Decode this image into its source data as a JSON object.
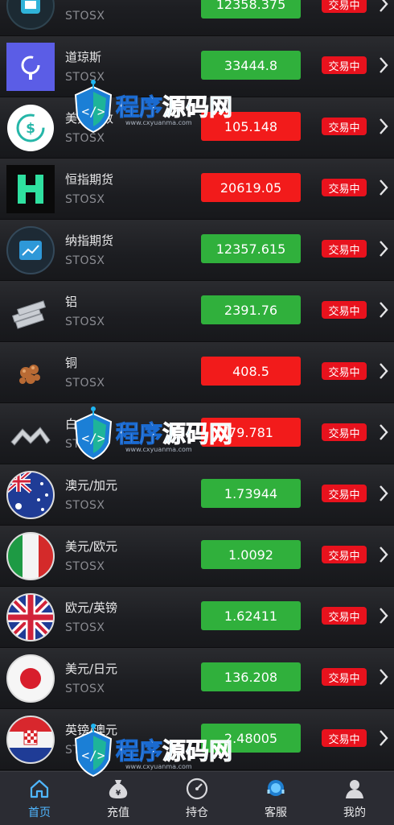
{
  "rows": [
    {
      "name": "",
      "sub": "STOSX",
      "price": "12358.375",
      "dir": "up",
      "status": "交易中",
      "icon": "circle-app-icon"
    },
    {
      "name": "道琼斯",
      "sub": "STOSX",
      "price": "33444.8",
      "dir": "up",
      "status": "交易中",
      "icon": "dow-jones-logo-icon"
    },
    {
      "name": "美元指数",
      "sub": "STOSX",
      "price": "105.148",
      "dir": "down",
      "status": "交易中",
      "icon": "dollar-index-icon"
    },
    {
      "name": "恒指期货",
      "sub": "STOSX",
      "price": "20619.05",
      "dir": "down",
      "status": "交易中",
      "icon": "hang-seng-logo-icon"
    },
    {
      "name": "纳指期货",
      "sub": "STOSX",
      "price": "12357.615",
      "dir": "up",
      "status": "交易中",
      "icon": "nasdaq-chart-icon"
    },
    {
      "name": "铝",
      "sub": "STOSX",
      "price": "2391.76",
      "dir": "up",
      "status": "交易中",
      "icon": "aluminum-bars-icon"
    },
    {
      "name": "铜",
      "sub": "STOSX",
      "price": "408.5",
      "dir": "down",
      "status": "交易中",
      "icon": "copper-nuggets-icon"
    },
    {
      "name": "白",
      "sub": "STOSX",
      "price": "79.781",
      "dir": "down",
      "status": "交易中",
      "icon": "metal-trend-icon"
    },
    {
      "name": "澳元/加元",
      "sub": "STOSX",
      "price": "1.73944",
      "dir": "up",
      "status": "交易中",
      "icon": "australia-flag-icon"
    },
    {
      "name": "美元/欧元",
      "sub": "STOSX",
      "price": "1.0092",
      "dir": "up",
      "status": "交易中",
      "icon": "italy-flag-icon"
    },
    {
      "name": "欧元/英镑",
      "sub": "STOSX",
      "price": "1.62411",
      "dir": "up",
      "status": "交易中",
      "icon": "uk-flag-icon"
    },
    {
      "name": "美元/日元",
      "sub": "STOSX",
      "price": "136.208",
      "dir": "up",
      "status": "交易中",
      "icon": "japan-flag-icon"
    },
    {
      "name": "英镑/澳元",
      "sub": "STOSX",
      "price": "2.48005",
      "dir": "up",
      "status": "交易中",
      "icon": "croatia-flag-icon"
    }
  ],
  "tabs": [
    {
      "label": "首页",
      "icon": "home-icon",
      "active": true
    },
    {
      "label": "充值",
      "icon": "money-bag-icon",
      "active": false
    },
    {
      "label": "持仓",
      "icon": "gauge-icon",
      "active": false
    },
    {
      "label": "客服",
      "icon": "headset-icon",
      "active": false
    },
    {
      "label": "我的",
      "icon": "user-icon",
      "active": false
    }
  ],
  "watermark": {
    "part1": "程序",
    "part2": "源码网",
    "url": "www.cxyuanma.com"
  },
  "colors": {
    "up": "#30b03c",
    "down": "#f21b1b",
    "status": "#e8121d",
    "active_tab": "#4fb6ff"
  }
}
